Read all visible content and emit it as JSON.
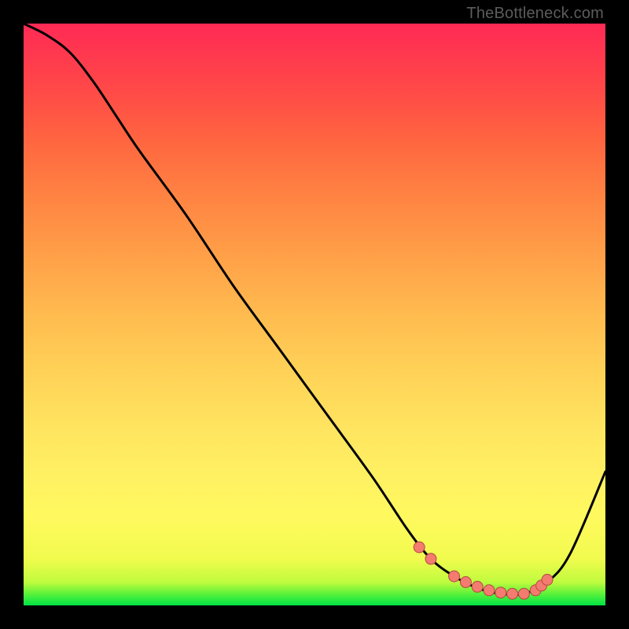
{
  "watermark": "TheBottleneck.com",
  "colors": {
    "curve_stroke": "#000000",
    "dot_fill": "#f47b6f",
    "dot_stroke": "#b24a42"
  },
  "chart_data": {
    "type": "line",
    "title": "",
    "xlabel": "",
    "ylabel": "",
    "xlim": [
      0,
      100
    ],
    "ylim": [
      0,
      100
    ],
    "series": [
      {
        "name": "bottleneck-curve",
        "x": [
          0,
          4,
          8,
          12,
          16,
          20,
          28,
          36,
          44,
          52,
          60,
          66,
          70,
          74,
          78,
          82,
          86,
          90,
          94,
          100
        ],
        "y": [
          100,
          98,
          95,
          90,
          84,
          78,
          67,
          55,
          44,
          33,
          22,
          13,
          8,
          5,
          3,
          2,
          2,
          4,
          9,
          23
        ]
      }
    ],
    "markers": {
      "name": "highlight-dots",
      "x": [
        68,
        70,
        74,
        76,
        78,
        80,
        82,
        84,
        86,
        88,
        89,
        90
      ],
      "y": [
        10,
        8,
        5,
        4,
        3.2,
        2.6,
        2.2,
        2.0,
        2.0,
        2.6,
        3.4,
        4.4
      ]
    }
  }
}
